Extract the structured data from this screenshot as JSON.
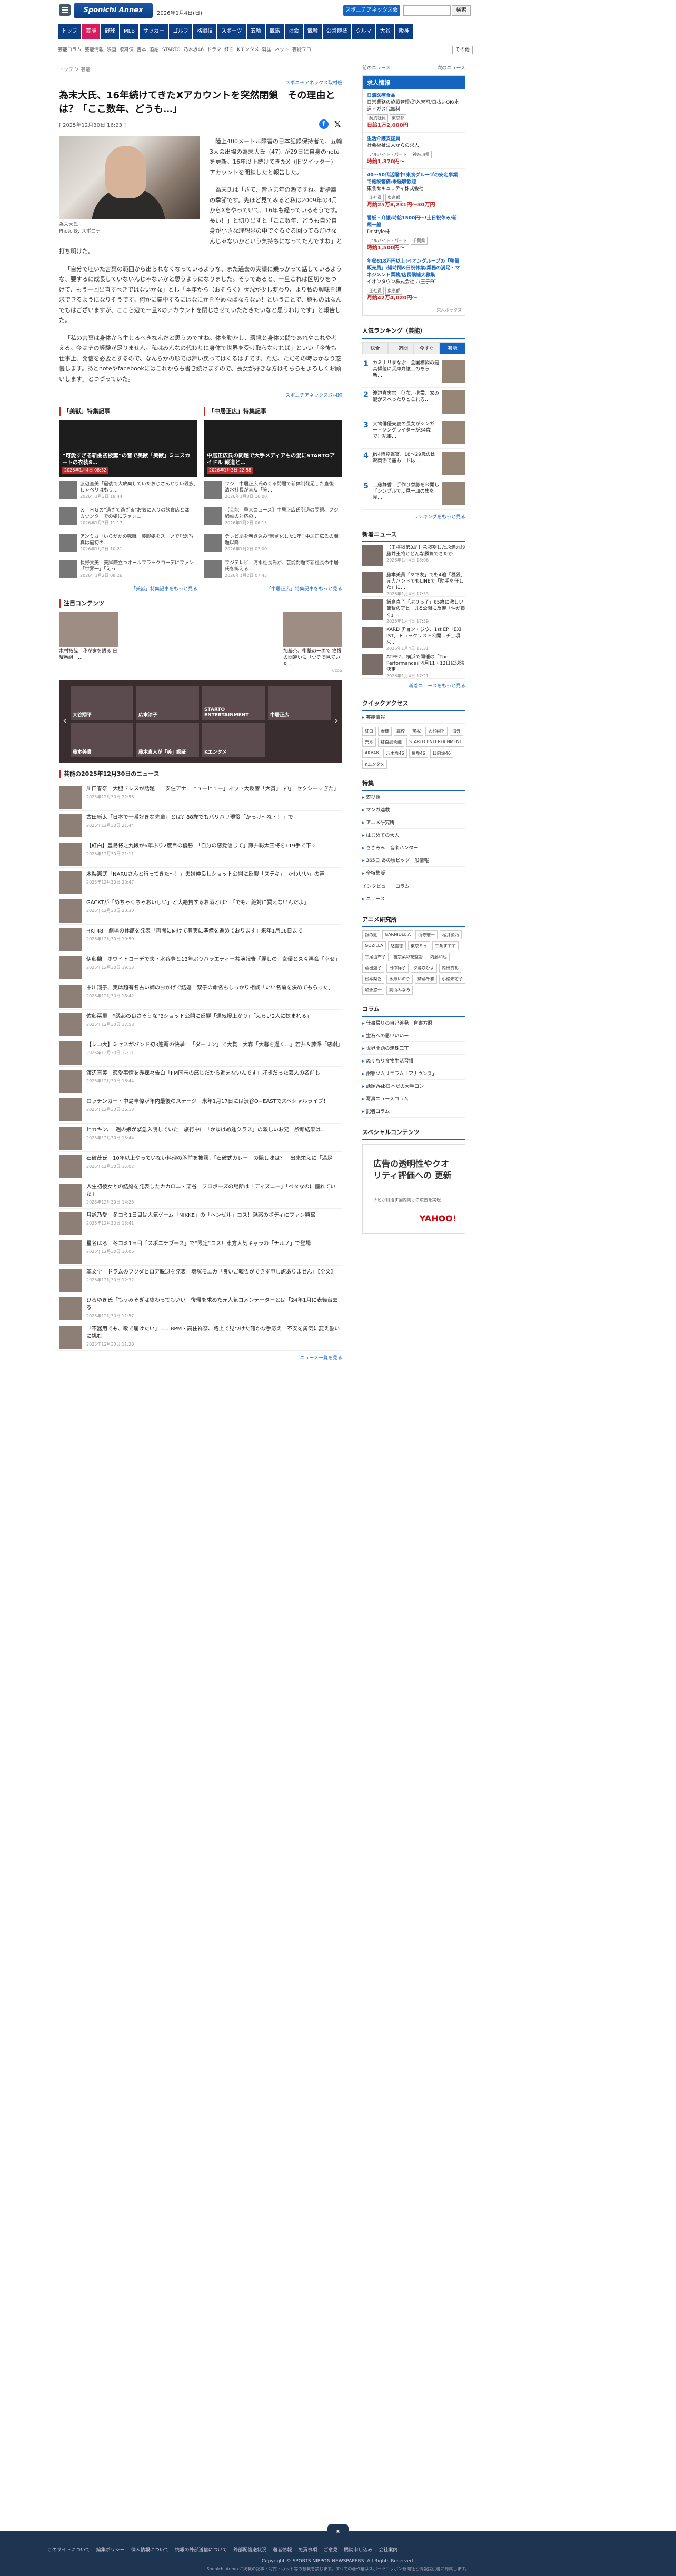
{
  "header": {
    "logo": "Sponichi Annex",
    "date": "2026年1月4日(日)",
    "login_btn": "スポニチアネックス会員登録",
    "search_btn": "検索"
  },
  "nav_main": [
    "トップ",
    "芸能",
    "野球",
    "MLB",
    "サッカー",
    "ゴルフ",
    "格闘技",
    "スポーツ",
    "五輪",
    "競馬",
    "社会",
    "競輪",
    "公営競技",
    "クルマ",
    "大谷",
    "阪神"
  ],
  "nav_sub": [
    "芸能コラム",
    "芸能情報",
    "映画",
    "歌舞伎",
    "吉本",
    "落語",
    "STARTO",
    "乃木坂46",
    "ドラマ",
    "紅白",
    "Kエンタメ",
    "韓国",
    "ネット",
    "芸能プロ"
  ],
  "nav_sub_more": "その他",
  "breadcrumb": "トップ ＞ 芸能",
  "article": {
    "source": "スポニチアネックス取材班",
    "title": "為末大氏、16年続けてきたXアカウントを突然閉鎖　その理由とは？「ここ数年、どうも…」",
    "date": "[ 2025年12月30日 16:23 ]",
    "photo_caption": "為末大氏",
    "photo_credit": "Photo By スポニチ",
    "p1": "陸上400メートル障害の日本記録保持者で、五輪3大会出場の為末大氏（47）が29日に自身のnoteを更新。16年以上続けてきたX（旧ツイッター）アカウントを閉鎖したと報告した。",
    "p2": "為末氏は「さて、皆さま年の瀬ですね。断捨離の季節です。先ほど見てみると私は2009年の4月からXをやっていて、16年も経っているそうです。長い！」と切り出すと「ここ数年、どうも自分自身が小さな理想界の中でぐるぐる回ってるだけなんじゃないかという気持ちになってたんですね」と打ち明けた。",
    "p3": "「自分で吐いた言葉の範囲から出られなくなっているような、また過去の実績に乗っかって話しているような、要するに成長していないんじゃないかと思うようになりました。そうであると、一旦これは区切りをつけて、もう一回出直すべきではないかな」とし「本年から（おそらく）状況が少し変わり、より私の興味を追求できるようになりそうです。何かに集中するにはなにかをやめなばならない！ということで、継ものはなんでもはございますが、ここら辺で一旦Xのアカウントを閉じさせていただきたいなと思うわけです」と報告した。",
    "p4": "「私の言葉は身体から生じるべきなんだと思うのですね。体を動かし、環境と身体の間であれやこれや考える。今はその経験が足りません。私はみんなの代わりに身体で世界を受け取らなければ」といい「今後も仕事上、発信を必要とするので、なんらかの形では舞い戻ってはくるはずです。ただ、ただその時はかなり惑慢します。あとnoteやfacebookにはこれからも書き続けますので、長女が好きな方はそちらもよろしくお願いします」とつづっていた。",
    "source_bottom": "スポニチアネックス取材班"
  },
  "features": [
    {
      "title": "「美獣」特集記事",
      "main": "“可愛すぎる新曲初披露”の音で美獣「美獣」ミニスカートの衣装S…",
      "date": "2026年1月4日 08:32",
      "items": [
        {
          "t": "渡辺直美「最後で大放棄していたおじさんとりい親族」しゃべりはもう…",
          "d": "2026年1月3日 18:44"
        },
        {
          "t": "ＸＴＨＧの“過ぎて過ぎる”お気に入りの飲食店とは　カウンターでの姿にファン…",
          "d": "2026年1月3日 11:17"
        },
        {
          "t": "アンミカ「いらがかの転職」美脚姿をスーツで記念写真は最初の…",
          "d": "2026年1月2日 10:21"
        },
        {
          "t": "長野文美　美脚際立つオールブラックコーデにファン「世界一」「えっ…",
          "d": "2026年1月2日 08:26"
        }
      ],
      "more": "「美獣」特集記事をもっと見る"
    },
    {
      "title": "「中居正広」特集記事",
      "main": "中居正広氏の問題で大手メディアもの混にSTARTOアイドル 報道と…",
      "date": "2026年1月3日 22:58",
      "items": [
        {
          "t": "フジ　中居正広氏めぐる問題で新体制発足した直後　清水社長が言及「答…",
          "d": "2026年1月3日 16:00"
        },
        {
          "t": "【芸能　重大ニュース】中居正広氏引退の問題、フジ騒動の対応の…",
          "d": "2026年1月2日 06:15"
        },
        {
          "t": "テレビ局を巻き込み“騒動化した1年” 中居正広氏の問題以降…",
          "d": "2026年1月2日 07:00"
        },
        {
          "t": "フジテレビ　清水社長氏が、芸能問題で新社長の中居氏を訴える…",
          "d": "2026年1月2日 07:45"
        }
      ],
      "more": "「中居正広」特集記事をもっと見る"
    }
  ],
  "attention": {
    "title": "注目コンテンツ",
    "items": [
      {
        "t": "木村拓哉　我が家を語る 日曜番組　..."
      },
      {
        "t": ""
      },
      {
        "t": ""
      },
      {
        "t": "加藤茶、衝撃の一面で 痛恨の間違いに「ウチで見ていた…"
      }
    ],
    "ad_label": "uzou"
  },
  "slider": [
    "大谷翔平",
    "広末涼子",
    "STARTO ENTERTAINMENT",
    "中居正広",
    "藤本美貴",
    "藤木直人が「美」認証",
    "Kエンタメ"
  ],
  "news_list": {
    "title": "芸能の2025年12月30日のニュース",
    "items": [
      {
        "t": "川口春奈　大胆ドレスが話題！　安住アナ「ヒューヒュー」ネット大反響「大賞」「神」「セクシーすぎた」",
        "d": "2025年12月30日 22:56"
      },
      {
        "t": "古田新太「日本で一番好きな先輩」とは？88歳でもバリバリ現役「かっけ〜な・！」で",
        "d": "2025年12月30日 21:44"
      },
      {
        "t": "【紅白】豊島将之九段が6年ぶり2度目の優勝　「自分の感覚信じて」藤井聡太王将を119手で下す",
        "d": "2025年12月30日 21:11"
      },
      {
        "t": "木梨憲武「NARUさんと行ってきた～！」夫婦仲良しショット公開に反響「ステキ」「かわいい」の声",
        "d": "2025年12月30日 20:47"
      },
      {
        "t": "GACKTが「めちゃくちゃおいしい」と大絶賛するお酒とは？「でも、絶対に買えないんだよ」",
        "d": "2025年12月30日 20:30"
      },
      {
        "t": "HKT48　劇場の休館を発表「再開に向けて着実に準備を進めております」来年1月16日まで",
        "d": "2025年12月30日 19:50"
      },
      {
        "t": "伊藤蘭　ホワイトコーデで夫・水谷豊と13年ぶりバラエティー共演報告「麗しの」女優と久々再会「幸せ」",
        "d": "2025年12月30日 19:13"
      },
      {
        "t": "中川翔子、実は超有名占い師のおかげで結婚！双子の命名もしっかり相談「いい名前を決めてもらった」",
        "d": "2025年12月30日 18:42"
      },
      {
        "t": "佐藤栞里　“縁起の良さそうな”3ショット公開に反響「運気爆上がり」「えらい2人に挟まれる」",
        "d": "2025年12月30日 17:58"
      },
      {
        "t": "【レコ大】ミセスがバンド初3連覇の快挙！「ダーリン」で大賞　大森「大暮を過く…」若井＆藤澤「感謝」",
        "d": "2025年12月30日 17:11"
      },
      {
        "t": "渡辺直美　恋愛事情を赤裸々告白「FM同志の感じだから進まないんです」好きだった芸人の名前も",
        "d": "2025年12月30日 16:44"
      },
      {
        "t": "ロッチンガー・中島卓偉が年内最後のステージ　来年1月17日には渋谷O−EASTでスペシャルライブ！",
        "d": "2025年12月30日 16:13"
      },
      {
        "t": "ヒカキン、1週の娘が緊急入院していた　旅行中に「かゆはめ途クラス」の激しいお兄　診断結果は…",
        "d": "2025年12月30日 15:44"
      },
      {
        "t": "石破茂氏　10年以上やっていない料理の腕前を披露、「石破式カレー」の隠し味は？　出来栄えに「満足」",
        "d": "2025年12月30日 15:02"
      },
      {
        "t": "人生初彼女との結婚を発表したカカロニ・栗谷　プロポーズの場所は「ディズニー」「ベタなのに憧れていた」",
        "d": "2025年12月30日 14:25"
      },
      {
        "t": "月詠乃愛　冬コミ1日目は人気ゲーム「NIKKE」の「ヘンゼル」コス！魅惑のボディにファン興奮",
        "d": "2025年12月30日 13:41"
      },
      {
        "t": "星名はる　冬コミ1日目「スポニチブース」で“限定”コス！東方人気キャラの「チルノ」で登場",
        "d": "2025年12月30日 13:06"
      },
      {
        "t": "革文学　ドラムのフクダヒロア脱退を発表　塩塚モエカ「良いご報告ができず申し訳ありません」【全文】",
        "d": "2025年12月30日 12:32"
      },
      {
        "t": "ひろゆき氏「もうみそぎは終わってもいい」復帰を求めた元人気コメンテーターとは「24年1月に表舞台去る",
        "d": "2025年12月30日 11:57"
      },
      {
        "t": "「不器用でも、歌で届けたい」……BPM・高住祥奈、路上で見つけた確かな手応え　不安を勇気に変え誓いに挑む",
        "d": "2025年12月30日 11:20"
      }
    ],
    "more": "ニュース一覧を見る"
  },
  "side": {
    "pager_prev": "前のニュース",
    "pager_next": "次のニュース",
    "jobs_title": "求人情報",
    "jobs": [
      {
        "name": "日清医療食品",
        "desc": "日常業務の施設管理/即入寮可/日払いOK/水道・ガス代無料",
        "tags": [
          "契約社員",
          "東京都"
        ],
        "pay": "日給1万2,000円"
      },
      {
        "name": "生活介護支援員",
        "desc": "社会福祉法人からの求人",
        "tags": [
          "アルバイト・パート",
          "神奈川県"
        ],
        "pay": "時給1,370円〜"
      },
      {
        "name": "40〜50代活躍中!東食グループの安定事業で施設警備/未経験歓迎",
        "desc": "東食セキュリティ株式会社",
        "tags": [
          "正社員",
          "東京都"
        ],
        "pay": "月給25万8,231円〜30万円"
      },
      {
        "name": "看板・介護/時給1500円〜!土日祝休み/新規一般",
        "desc": "Dr.style株",
        "tags": [
          "アルバイト・パート",
          "千葉県"
        ],
        "pay": "時給1,500円〜"
      },
      {
        "name": "年収618万円以上!イオングループの「整備販売員」/短時間&日祝休業/業務の満足・マネジメント業務/店長候補大募集",
        "desc": "イオンタウン株式会社 八王子EC",
        "tags": [
          "正社員",
          "東京都"
        ],
        "pay": "月給42万4,020円〜"
      }
    ],
    "jobs_footer": "求人ボックス",
    "ranking_title": "人気ランキング（芸能）",
    "ranking_tabs": [
      "総合",
      "一週間",
      "今すぐ",
      "芸能"
    ],
    "ranking": [
      {
        "n": "1",
        "t": "カミナリまなぶ　全国構図の最高傾位に兵庫弁護士のちら　新…"
      },
      {
        "n": "2",
        "t": "渡辺真実官　財布、携帯、家の鍵がスべったりとこれる…"
      },
      {
        "n": "3",
        "t": "大物俳優夫妻の長女がシンガー・ソングライターが34歳で！記事…"
      },
      {
        "n": "4",
        "t": "JN4博覧鑑賞、18〜29歳の比較関係で最も　ドは…"
      },
      {
        "n": "5",
        "t": "工藤静香　手作り煮豚を公開し「シンプルで…見一皿の集を見…"
      }
    ],
    "ranking_more": "ランキングをもっと見る",
    "new_title": "新着ニュース",
    "new_items": [
      {
        "t": "【王将戦第3局】急戦割した永瀬九段　藤井王将とどんな勝負できたか",
        "d": "2026年1月4日 18:06"
      },
      {
        "t": "藤本美貴「ママ友」でも4遍「凝親」元大バンドでもLINEで「助手を仔した」に…",
        "d": "2026年1月4日 17:53"
      },
      {
        "t": "飯島直子「ぶりっ子」65歳に激しい節腎のアピール5公開に反響「仲が良く」…",
        "d": "2026年1月4日 17:39"
      },
      {
        "t": "KARD チョン・ジウ、1st EP「EXI IST」トラックリスト公開…チェ頃来…",
        "d": "2026年1月4日 17:31"
      },
      {
        "t": "ATEEZ、横浜で開催の「The Performance」4月11・12日に決演決定",
        "d": "2026年1月4日 17:21"
      }
    ],
    "new_more": "新着ニュースをもっと見る",
    "quick_title": "クイックアクセス",
    "quick_list": [
      "芸能情報"
    ],
    "quick_tags": [
      "紅白",
      "野球",
      "高校",
      "宝塚",
      "大谷翔平",
      "海外",
      "吉本",
      "紅白歌合戦",
      "STARTO ENTERTAINMENT",
      "AKB48",
      "乃木坂46",
      "欅坂46",
      "日向坂46",
      "Kエンタメ"
    ],
    "special_title": "特集",
    "special": [
      "遊び話",
      "マンガ連載",
      "アニメ研究所",
      "はじめての大人",
      "ききみみ　音楽ハンター",
      "365日 あの頃ビッグ一般情報",
      "全特集版"
    ],
    "interview": "インタビュー　コラム",
    "news_list2": [
      "ニュース"
    ],
    "anime_title": "アニメ研究所",
    "anime_tags": [
      "銀の匙",
      "GARNIDELiA",
      "山寺宏一",
      "桜井薫乃",
      "GOZILLA",
      "悠雲徳",
      "東京ミュ",
      "三条すずす",
      "三尾由布子",
      "吉宗菜彩花監督",
      "内藤和也",
      "藤出遊子",
      "日中祥子",
      "夕暮ひひよ",
      "内田真礼",
      "松本梨香",
      "水瀬いのり",
      "斎藤千和",
      "小松未可子",
      "加永悠一",
      "高山みなみ"
    ],
    "column_title": "コラム",
    "columns": [
      "仕事帰りの自己啓発　倉書方暦",
      "蛍石への思いいいー",
      "世界問題の連珠三丁",
      "ぬくもり食物生活習慣",
      "謝罪ソムリエラム「アナウンス」",
      "話題Web日本だの大手ロン",
      "写真ニュースコラム",
      "記者コラム"
    ],
    "sp_title": "スペシャルコンテンツ",
    "ad_text": "広告の透明性やクオリティ評価への 更新",
    "ad_sub": "ナビが目指す国内向けの広告を実現",
    "ad_brand": "YAHOO!"
  },
  "footer": {
    "links": [
      "このサイトについて",
      "編集ポリシー",
      "個人情報について",
      "情報の外部送信について",
      "外部配信送状況",
      "著者情報",
      "免責事項",
      "ご意見",
      "購読申し込み",
      "会社案内"
    ],
    "copyright": "Copyright © SPORTS NIPPON NEWSPAPERS. All Rights Reserved.",
    "note": "Sponichi Annexに掲載の記事・写真・カット等の転載を禁じます。すべての著作権はスポーツニッポン新聞社と情報提供者に帰属します。"
  }
}
